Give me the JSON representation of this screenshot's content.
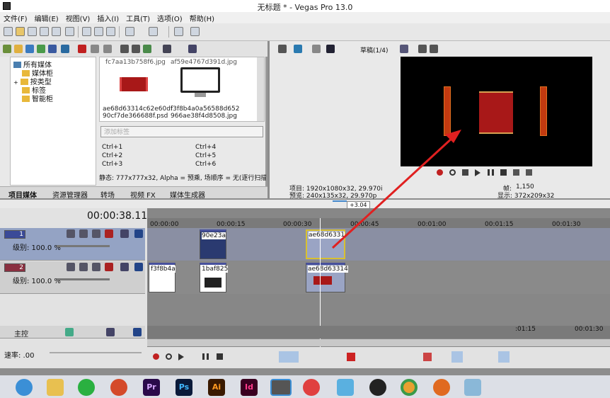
{
  "window": {
    "title": "无标题 * - Vegas Pro 13.0"
  },
  "menu": [
    "文件(F)",
    "编辑(E)",
    "视图(V)",
    "插入(I)",
    "工具(T)",
    "选项(O)",
    "帮助(H)"
  ],
  "explorer": {
    "tree": [
      "所有媒体",
      "媒体柜",
      "按类型",
      "标签",
      "智能柜"
    ],
    "files": [
      {
        "top": "fc7aa13b758f6.jpg",
        "name": "ae68d63314c62e60df\n90cf7de366688f.psd"
      },
      {
        "top": "af59e4767d391d.jpg",
        "name": "f3f8b4a0a56588d652\n966ae38f4d8508.jpg"
      }
    ],
    "tag_placeholder": "添加标签",
    "shortcuts": [
      "Ctrl+1",
      "Ctrl+2",
      "Ctrl+3",
      "Ctrl+4",
      "Ctrl+5",
      "Ctrl+6"
    ],
    "status": "静态: 777x777x32, Alpha = 预乘, 场顺序 = 无(逐行扫描), 3",
    "tabs": [
      "项目媒体",
      "资源管理器",
      "转场",
      "视频 FX",
      "媒体生成器"
    ]
  },
  "preview": {
    "quality": "草稿(1/4)",
    "project": "项目: 1920x1080x32, 29.970i",
    "preview": "预览: 240x135x32, 29.970p",
    "frame_label": "帧:",
    "frame": "1,150",
    "display": "显示: 372x209x32"
  },
  "timeline": {
    "time": "00:00:38.11",
    "offset": "+3.04",
    "ticks": [
      "00:00:00",
      "00:00:15",
      "00:00:30",
      "00:00:45",
      "00:01:00",
      "00:01:15",
      "00:01:30"
    ],
    "tracks": [
      {
        "num": "1",
        "level": "级别: 100.0 %"
      },
      {
        "num": "2",
        "level": "级别: 100.0 %"
      }
    ],
    "clips": {
      "t1a": "90e23a",
      "t1b": "ae68d6331",
      "t2a": "f3f8b4a",
      "t2b": "1baf825",
      "t2c": "ae68d63314"
    },
    "master": "主控",
    "rate": "速率: .00",
    "bottom_ticks": [
      ":01:15",
      "00:01:30"
    ]
  },
  "taskbar": [
    "Pr",
    "Ps",
    "Ai",
    "Id"
  ],
  "colors": {
    "accent": "#4a5fa8",
    "track1": "#4d5da8",
    "track2": "#8a3040",
    "arrow": "#e02020"
  }
}
